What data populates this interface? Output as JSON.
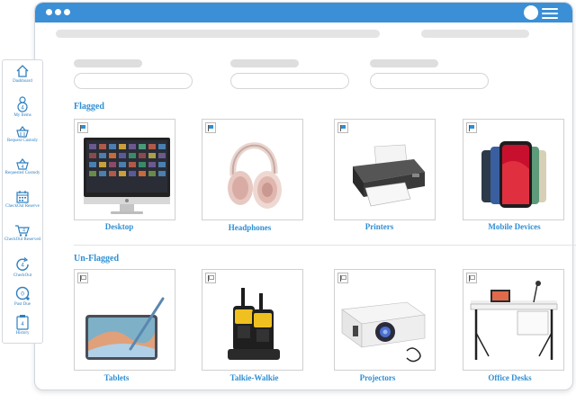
{
  "sidebar": {
    "items": [
      {
        "label": "Dashboard",
        "icon": "home-icon"
      },
      {
        "label": "My Items",
        "icon": "user-icon",
        "badge": "4"
      },
      {
        "label": "Request Custody",
        "icon": "basket-icon"
      },
      {
        "label": "Requested Custody",
        "icon": "basket-badge-icon",
        "badge": "4"
      },
      {
        "label": "CheckOut Reserve",
        "icon": "calendar-icon"
      },
      {
        "label": "CheckOut Reserved",
        "icon": "cart-icon",
        "badge": "4"
      },
      {
        "label": "CheckOut",
        "icon": "refresh-icon",
        "badge": "4"
      },
      {
        "label": "Past Due",
        "icon": "clock-icon",
        "badge": "0"
      },
      {
        "label": "History",
        "icon": "clipboard-icon",
        "badge": "4"
      }
    ]
  },
  "flagged": {
    "title": "Flagged",
    "items": [
      {
        "label": "Desktop"
      },
      {
        "label": "Headphones"
      },
      {
        "label": "Printers"
      },
      {
        "label": "Mobile Devices"
      }
    ]
  },
  "unflagged": {
    "title": "Un-Flagged",
    "items": [
      {
        "label": "Tablets"
      },
      {
        "label": "Talkie-Walkie"
      },
      {
        "label": "Projectors"
      },
      {
        "label": "Office Desks"
      }
    ]
  },
  "colors": {
    "accent": "#2e8fd4",
    "titlebar": "#3a8fd6"
  }
}
